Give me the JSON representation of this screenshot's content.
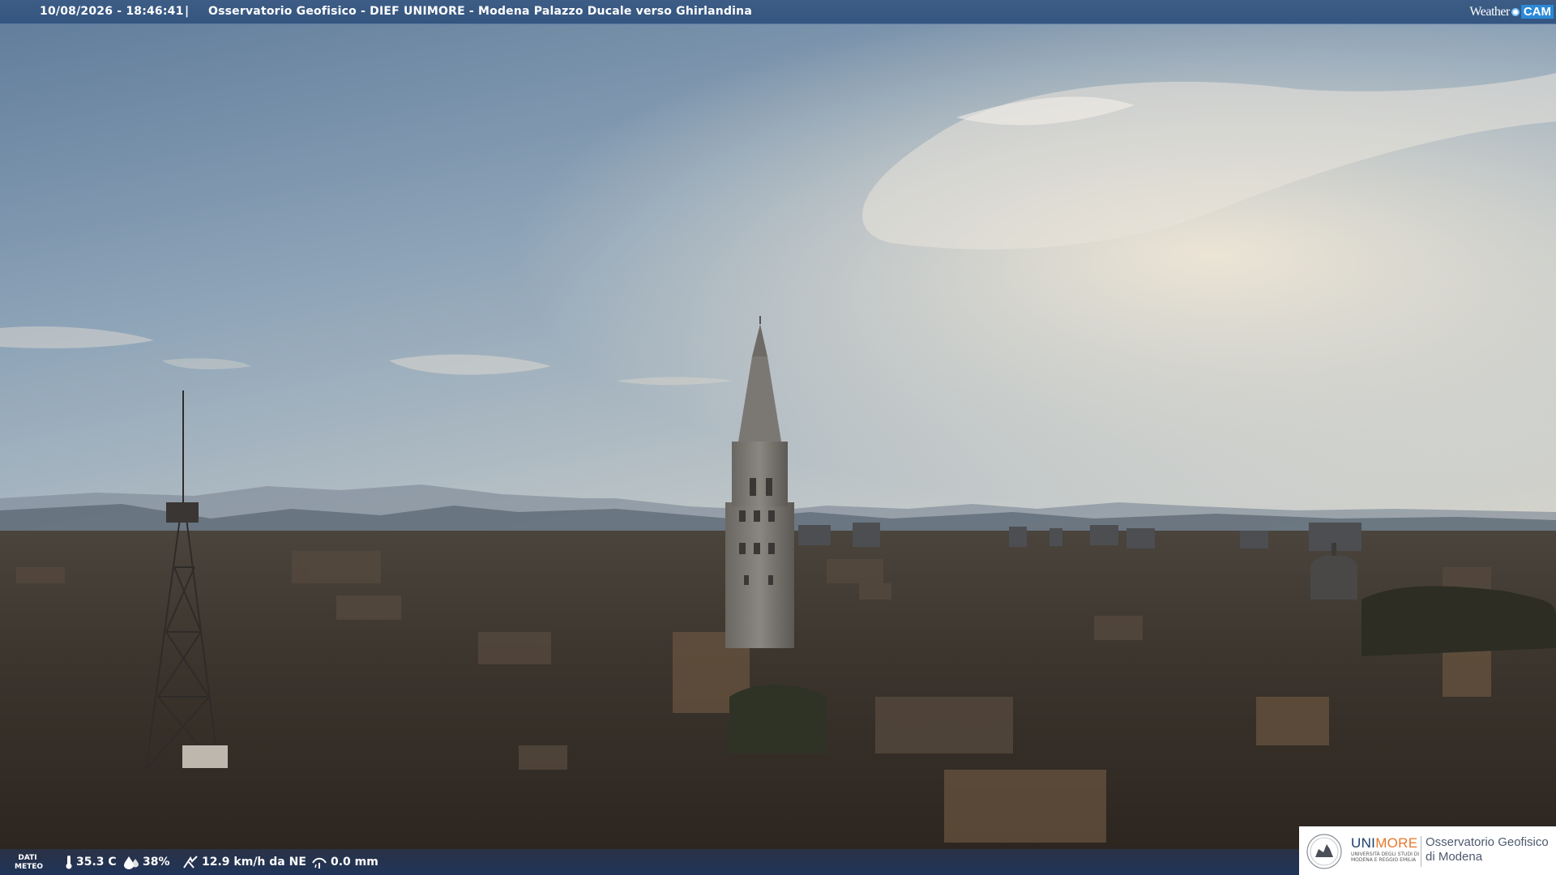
{
  "header": {
    "timestamp": "10/08/2026 - 18:46:41",
    "separator": "|",
    "title": "Osservatorio Geofisico - DIEF UNIMORE - Modena Palazzo Ducale verso Ghirlandina",
    "brand_weather": "Weather",
    "brand_cam": "CAM"
  },
  "weather": {
    "label_line1": "DATI",
    "label_line2": "METEO",
    "temperature": "35.3 C",
    "humidity": "38%",
    "wind": "12.9 km/h da NE",
    "rain": "0.0 mm",
    "icons": [
      "thermometer-icon",
      "humidity-icon",
      "wind-icon",
      "rain-gauge-icon"
    ]
  },
  "logo": {
    "uni_prefix": "UNI",
    "uni_suffix": "MORE",
    "uni_sub_1": "UNIVERSITÀ DEGLI STUDI DI",
    "uni_sub_2": "MODENA E REGGIO EMILIA",
    "observatory_1": "Osservatorio Geofisico",
    "observatory_2": "di Modena"
  },
  "colors": {
    "header_bg": "#3d5d86",
    "brand_blue": "#2a8ad8",
    "unimore_orange": "#e7772a",
    "unimore_blue": "#1b3e6e"
  }
}
